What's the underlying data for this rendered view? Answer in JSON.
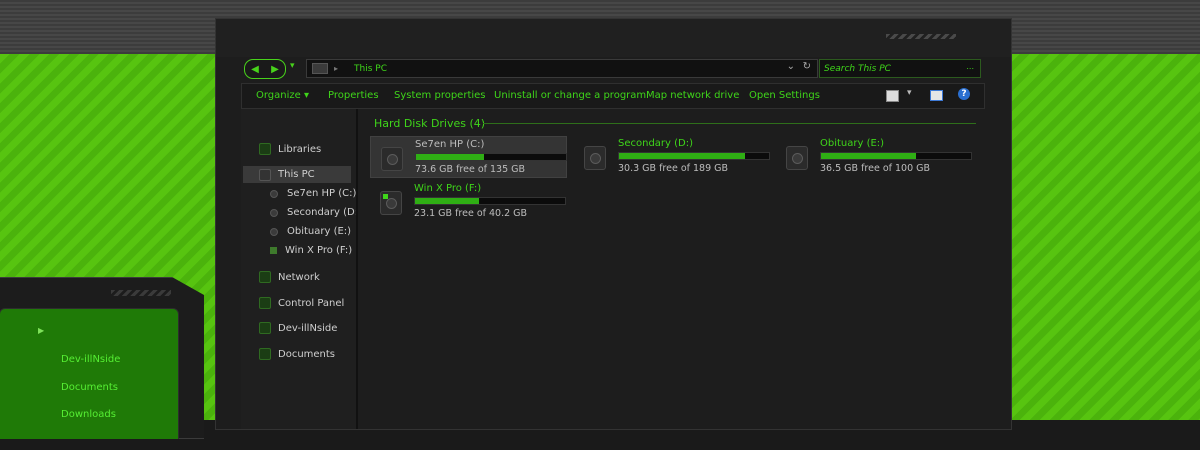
{
  "colors": {
    "accent": "#3fd51a",
    "desktop_green": "#57c410",
    "window_bg": "#1d1d1d"
  },
  "address_bar": {
    "path": "This PC",
    "refresh_icon": "refresh-icon",
    "dropdown_icon": "chevron-down-icon"
  },
  "search": {
    "placeholder": "Search This PC",
    "dots": "..."
  },
  "toolbar": {
    "organize": "Organize ▾",
    "properties": "Properties",
    "system_properties": "System properties",
    "uninstall": "Uninstall or change a program",
    "map_drive": "Map network drive",
    "open_settings": "Open Settings",
    "help": "?"
  },
  "nav_pane": {
    "libraries": "Libraries",
    "this_pc": "This PC",
    "drives": [
      "Se7en HP (C:)",
      "Secondary (D:)",
      "Obituary (E:)",
      "Win X Pro (F:)"
    ],
    "network": "Network",
    "control_panel": "Control Panel",
    "user": "Dev-illNside",
    "documents": "Documents"
  },
  "content": {
    "group_title": "Hard Disk Drives (4)",
    "drives": [
      {
        "name": "Se7en HP (C:)",
        "free_text": "73.6 GB free of 135 GB",
        "used_fraction": 0.455
      },
      {
        "name": "Secondary (D:)",
        "free_text": "30.3 GB free of 189 GB",
        "used_fraction": 0.84
      },
      {
        "name": "Obituary (E:)",
        "free_text": "36.5 GB free of 100 GB",
        "used_fraction": 0.635
      },
      {
        "name": "Win X Pro (F:)",
        "free_text": "23.1 GB free of 40.2 GB",
        "used_fraction": 0.425
      }
    ]
  },
  "mini_window": {
    "links": [
      "Dev-illNside",
      "Documents",
      "Downloads"
    ]
  }
}
